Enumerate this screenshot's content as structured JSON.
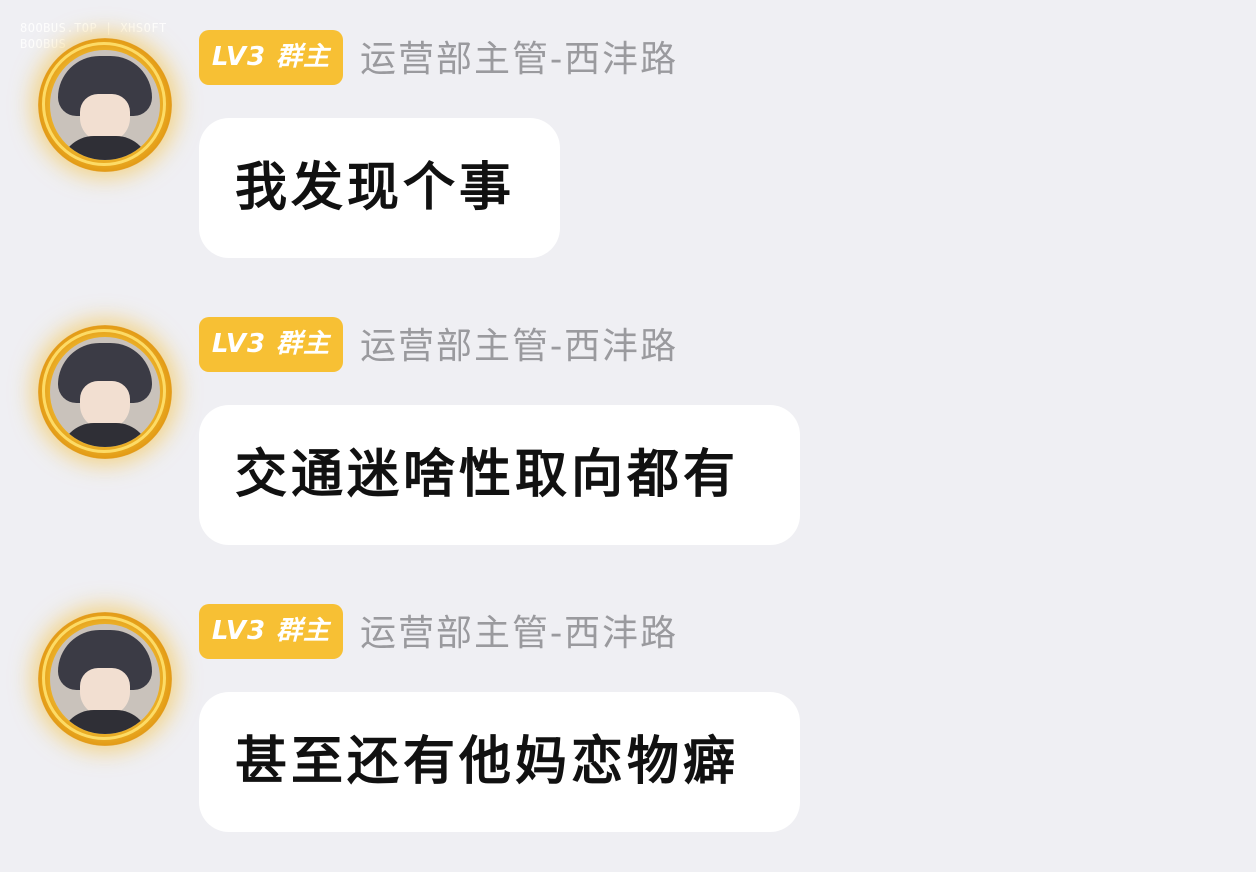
{
  "watermark": {
    "line1": "8OOBUS.TOP | XHSOFT",
    "line2": "BOOBUS"
  },
  "messages": [
    {
      "badge": "LV3 群主",
      "sender": "运营部主管-西沣路",
      "text": "我发现个事"
    },
    {
      "badge": "LV3 群主",
      "sender": "运营部主管-西沣路",
      "text": "交通迷啥性取向都有"
    },
    {
      "badge": "LV3 群主",
      "sender": "运营部主管-西沣路",
      "text": "甚至还有他妈恋物癖"
    }
  ],
  "colors": {
    "background": "#efeff3",
    "badge": "#f7c034",
    "bubble": "#ffffff",
    "sender_text": "#9a9a9e"
  }
}
